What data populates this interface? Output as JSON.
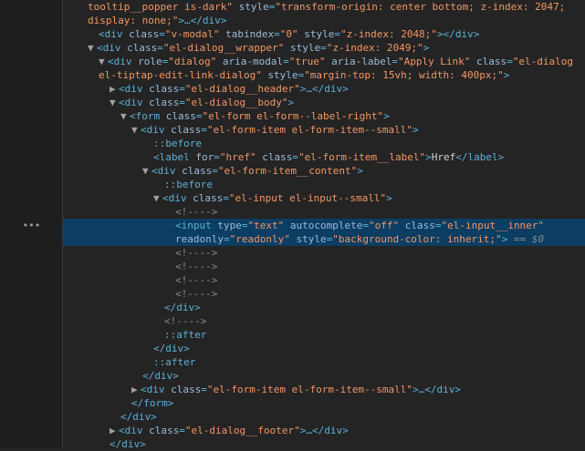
{
  "gutter": {
    "selection_marker": "•••"
  },
  "lines": {
    "l0": {
      "t1": "tooltip__popper is-dark\"",
      "a1": " style",
      "v1": "\"transform-origin: center bottom; z-index: 2047;"
    },
    "l1": {
      "v1": "display: none;\"",
      "p1": ">…</",
      "tag": "div",
      "p2": ">"
    },
    "l2": {
      "open": "<",
      "tag": "div",
      "a1": " class",
      "v1": "\"v-modal\"",
      "a2": " tabindex",
      "v2": "\"0\"",
      "a3": " style",
      "v3": "\"z-index: 2048;\"",
      "p1": "></",
      "tag2": "div",
      "p2": ">"
    },
    "l3": {
      "tri": "▼",
      "open": "<",
      "tag": "div",
      "a1": " class",
      "v1": "\"el-dialog__wrapper\"",
      "a2": " style",
      "v2": "\"z-index: 2049;\"",
      "close": ">"
    },
    "l4": {
      "tri": "▼",
      "open": "<",
      "tag": "div",
      "a1": " role",
      "v1": "\"dialog\"",
      "a2": " aria-modal",
      "v2": "\"true\"",
      "a3": " aria-label",
      "v3": "\"Apply Link\"",
      "a4": " class",
      "v4": "\"el-dialog"
    },
    "l5": {
      "v1": "el-tiptap-edit-link-dialog\"",
      "a1": " style",
      "v2": "\"margin-top: 15vh; width: 400px;\"",
      "close": ">"
    },
    "l6": {
      "tri": "▶",
      "open": "<",
      "tag": "div",
      "a1": " class",
      "v1": "\"el-dialog__header\"",
      "p1": ">…</",
      "tag2": "div",
      "close": ">"
    },
    "l7": {
      "tri": "▼",
      "open": "<",
      "tag": "div",
      "a1": " class",
      "v1": "\"el-dialog__body\"",
      "close": ">"
    },
    "l8": {
      "tri": "▼",
      "open": "<",
      "tag": "form",
      "a1": " class",
      "v1": "\"el-form el-form--label-right\"",
      "close": ">"
    },
    "l9": {
      "tri": "▼",
      "open": "<",
      "tag": "div",
      "a1": " class",
      "v1": "\"el-form-item el-form-item--small\"",
      "close": ">"
    },
    "l10": {
      "pseudo": "::before"
    },
    "l11": {
      "open": "<",
      "tag": "label",
      "a1": " for",
      "v1": "\"href\"",
      "a2": " class",
      "v2": "\"el-form-item__label\"",
      "p1": ">",
      "text": "Href",
      "p2": "</",
      "tag2": "label",
      "close": ">"
    },
    "l12": {
      "tri": "▼",
      "open": "<",
      "tag": "div",
      "a1": " class",
      "v1": "\"el-form-item__content\"",
      "close": ">"
    },
    "l13": {
      "pseudo": "::before"
    },
    "l14": {
      "tri": "▼",
      "open": "<",
      "tag": "div",
      "a1": " class",
      "v1": "\"el-input el-input--small\"",
      "close": ">"
    },
    "l15": {
      "cmt": "<!---->"
    },
    "l16": {
      "open": "<",
      "tag": "input",
      "a1": " type",
      "v1": "\"text\"",
      "a2": " autocomplete",
      "v2": "\"off\"",
      "a3": " class",
      "v3": "\"el-input__inner\""
    },
    "l17": {
      "a1": "readonly",
      "v1": "\"readonly\"",
      "a2": " style",
      "v2": "\"background-color: inherit;\"",
      "close": ">",
      "eq": " == $0"
    },
    "l18": {
      "cmt": "<!---->"
    },
    "l19": {
      "cmt": "<!---->"
    },
    "l20": {
      "cmt": "<!---->"
    },
    "l21": {
      "cmt": "<!---->"
    },
    "l22": {
      "p1": "</",
      "tag": "div",
      "close": ">"
    },
    "l23": {
      "cmt": "<!---->"
    },
    "l24": {
      "pseudo": "::after"
    },
    "l25": {
      "p1": "</",
      "tag": "div",
      "close": ">"
    },
    "l26": {
      "pseudo": "::after"
    },
    "l27": {
      "p1": "</",
      "tag": "div",
      "close": ">"
    },
    "l28": {
      "tri": "▶",
      "open": "<",
      "tag": "div",
      "a1": " class",
      "v1": "\"el-form-item el-form-item--small\"",
      "p1": ">…</",
      "tag2": "div",
      "close": ">"
    },
    "l29": {
      "p1": "</",
      "tag": "form",
      "close": ">"
    },
    "l30": {
      "p1": "</",
      "tag": "div",
      "close": ">"
    },
    "l31": {
      "tri": "▶",
      "open": "<",
      "tag": "div",
      "a1": " class",
      "v1": "\"el-dialog__footer\"",
      "p1": ">…</",
      "tag2": "div",
      "close": ">"
    },
    "l32": {
      "p1": "</",
      "tag": "div",
      "close": ">"
    }
  },
  "eq_sign": "="
}
